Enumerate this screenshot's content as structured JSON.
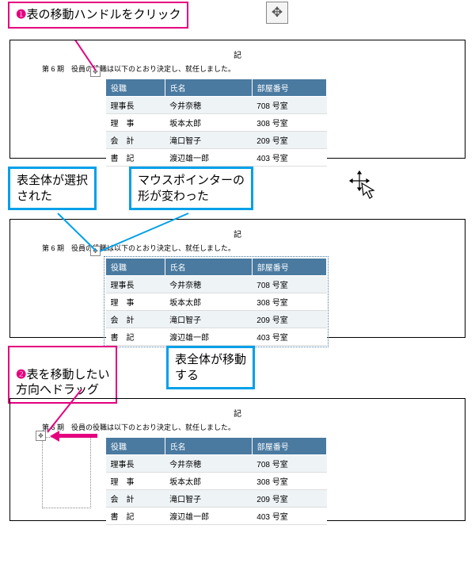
{
  "callouts": {
    "c1_prefix": "❶",
    "c1_text": "表の移動ハンドルをクリック",
    "c2a": "表全体が選択\nされた",
    "c2b": "マウスポインターの\n形が変わった",
    "c3_prefix": "❷",
    "c3_text": "表を移動したい\n方向へドラッグ",
    "c3b": "表全体が移動\nする"
  },
  "doc": {
    "heading": "記",
    "subhead": "第 6 期　役員の役職は以下のとおり決定し、就任しました。"
  },
  "table": {
    "headers": [
      "役職",
      "氏名",
      "部屋番号"
    ],
    "rows": [
      [
        "理事長",
        "今井奈穂",
        "708 号室"
      ],
      [
        "理　事",
        "坂本太郎",
        "308 号室"
      ],
      [
        "会　計",
        "滝口智子",
        "209 号室"
      ],
      [
        "書　記",
        "渡辺雄一郎",
        "403 号室"
      ]
    ]
  },
  "icons": {
    "move_handle": "✥",
    "cursor": "⤨"
  }
}
